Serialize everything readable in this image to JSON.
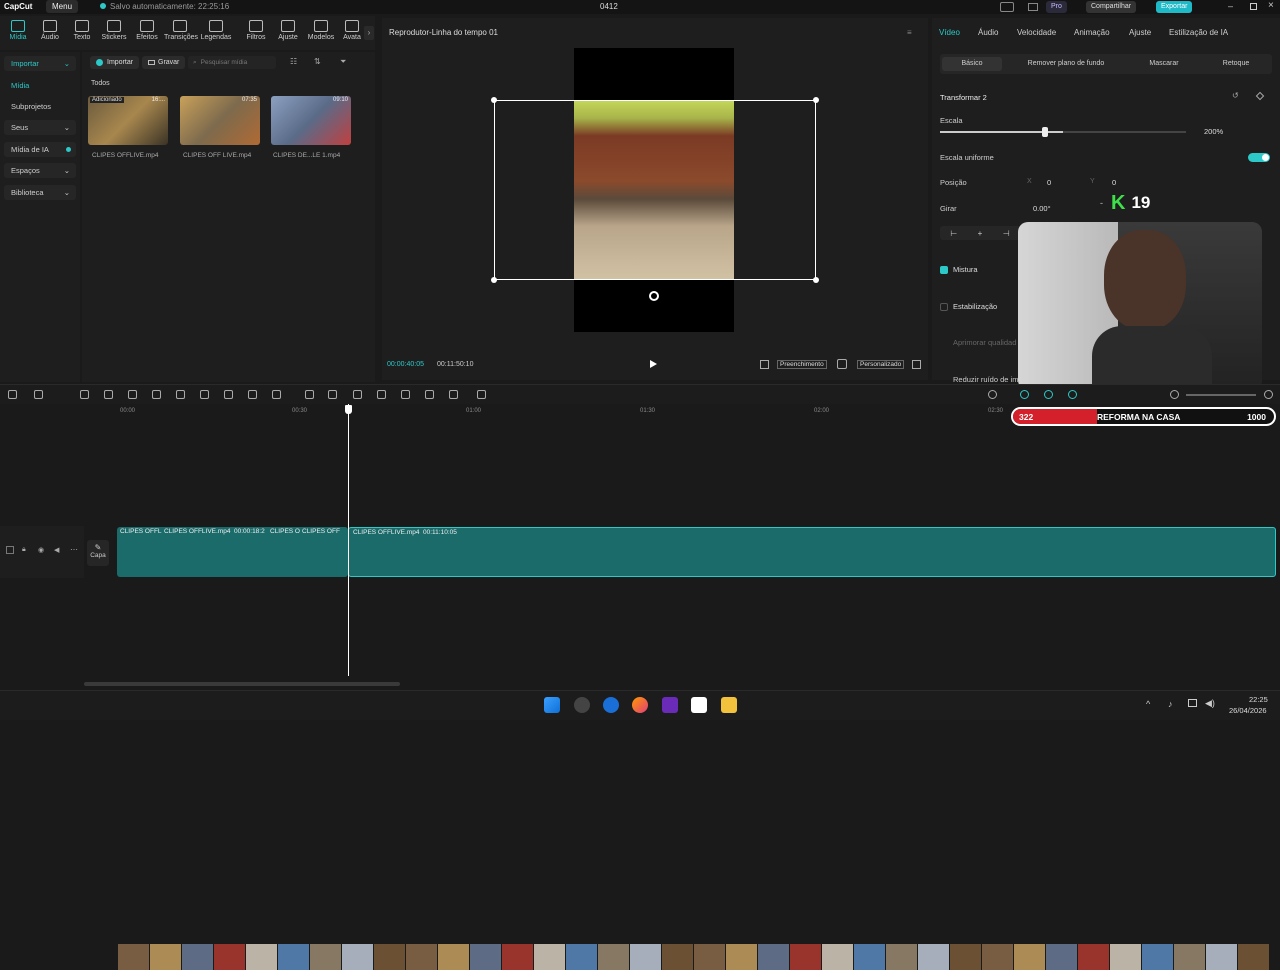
{
  "app": {
    "logo": "CapCut",
    "menu_label": "Menu",
    "autosave_text": "Salvo automaticamente: 22:25:16",
    "project_name": "0412",
    "pro_label": "Pro",
    "share_label": "Compartilhar",
    "export_label": "Exportar"
  },
  "toolbar": {
    "items": [
      "Mídia",
      "Áudio",
      "Texto",
      "Stickers",
      "Efeitos",
      "Transições",
      "Legendas",
      "Filtros",
      "Ajuste",
      "Modelos",
      "Avata"
    ]
  },
  "nav": {
    "items": [
      "Importar",
      "Mídia",
      "Subprojetos",
      "Seus",
      "Mídia de IA",
      "Espaços",
      "Biblioteca"
    ]
  },
  "media": {
    "import_label": "Importar",
    "record_label": "Gravar",
    "search_placeholder": "Pesquisar mídia",
    "filter_all": "Todos",
    "clips": [
      {
        "name": "CLIPES OFFLIVE.mp4",
        "badge": "Adicionado",
        "duration": "16:..."
      },
      {
        "name": "CLIPES OFF LIVE.mp4",
        "badge": "",
        "duration": "07:35"
      },
      {
        "name": "CLIPES DE...LE 1.mp4",
        "badge": "",
        "duration": "09:10"
      }
    ]
  },
  "player": {
    "title": "Reprodutor-Linha do tempo 01",
    "current_time": "00:00:40:05",
    "total_time": "00:11:50:10",
    "fill_label": "Preenchimento",
    "custom_label": "Personalizado"
  },
  "right_panel": {
    "tabs": [
      "Vídeo",
      "Áudio",
      "Velocidade",
      "Animação",
      "Ajuste",
      "Estilização de IA"
    ],
    "sub_tabs": [
      "Básico",
      "Remover plano de fundo",
      "Mascarar",
      "Retoque"
    ],
    "section_title": "Transformar 2",
    "scale_label": "Escala",
    "scale_value": "200%",
    "scale_fraction": 0.5,
    "uniform_label": "Escala uniforme",
    "position_label": "Posição",
    "x_label": "X",
    "x_value": "0",
    "y_label": "Y",
    "y_value": "0",
    "rotate_label": "Girar",
    "rotate_value": "0.00°",
    "mix_label": "Mistura",
    "stab_label": "Estabilização",
    "quality_label": "Aprimorar qualidad",
    "noise_label": "Reduzir ruído de im"
  },
  "overlay": {
    "kill_count": "19",
    "goal_current": "322",
    "goal_title": "REFORMA NA CASA",
    "goal_target": "1000",
    "goal_fraction": 0.322
  },
  "timeline": {
    "ticks": [
      "00:00",
      "00:30",
      "01:00",
      "01:30",
      "02:00",
      "02:30"
    ],
    "cover_label": "Capa",
    "clip_labels": [
      "CLIPES OFFL",
      "CLIPES OFFLIVE.mp4",
      "00:00:18:2",
      "CLIPES O",
      "CLIPES OFF"
    ],
    "main_clip_name": "CLIPES OFFLIVE.mp4",
    "main_clip_duration": "00:11:10:05"
  },
  "taskbar": {
    "time": "22:25",
    "date": "26/04/2026"
  },
  "colors": {
    "accent": "#2dc9c9",
    "export_bg": "#1fbac8"
  }
}
